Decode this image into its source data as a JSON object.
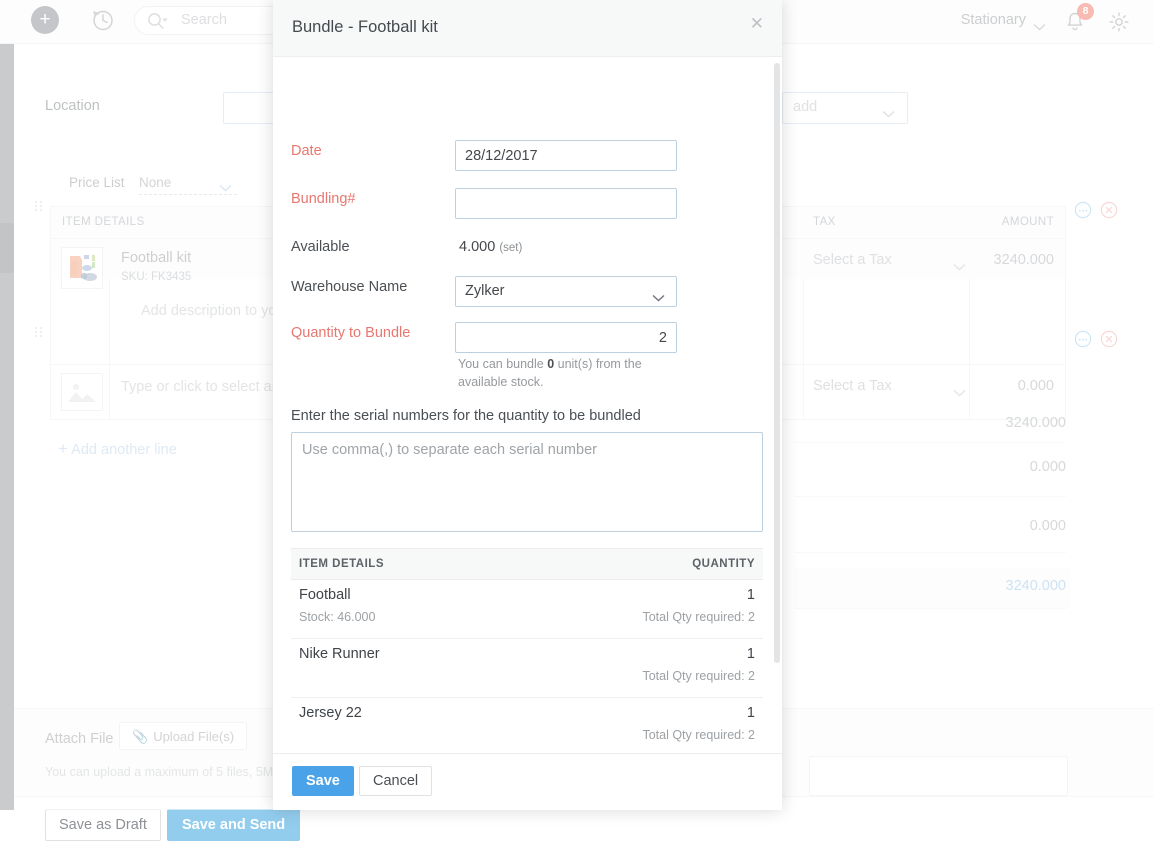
{
  "topbar": {
    "add_icon": "plus-circle-icon",
    "history_icon": "clock-history-icon",
    "search_placeholder": "Search",
    "search_icon": "search-icon",
    "organization": "Stationary",
    "org_caret_icon": "chevron-down-icon",
    "notifications_icon": "bell-icon",
    "notifications_count": "8",
    "settings_icon": "gear-icon"
  },
  "background_form": {
    "location_label": "Location",
    "location_value": "",
    "add_select_value": "add",
    "add_select_caret": "chevron-down-icon",
    "price_list_label": "Price List",
    "price_list_value": "None",
    "price_list_caret": "chevron-down-icon",
    "grid": {
      "columns": [
        "ITEM DETAILS",
        "TAX",
        "AMOUNT"
      ],
      "rows": [
        {
          "name": "Football kit",
          "sku": "SKU: FK3435",
          "description_placeholder": "Add description to your i",
          "tax": "Select a Tax",
          "amount": "3240.000",
          "thumbnail": "football-kit-thumbnail",
          "more_icon": "more-options-icon",
          "remove_icon": "remove-row-icon"
        },
        {
          "name": "",
          "sku": "",
          "description_placeholder": "Type or click to select an",
          "tax": "Select a Tax",
          "amount": "0.000",
          "thumbnail": "image-placeholder-icon",
          "more_icon": "more-options-icon",
          "remove_icon": "remove-row-icon"
        }
      ]
    },
    "add_line_label": "Add another line",
    "add_line_icon": "plus-icon",
    "totals": [
      "3240.000",
      "0.000",
      "0.000",
      "3240.000"
    ],
    "attach_label": "Attach File",
    "upload_button": "Upload File(s)",
    "upload_icon": "paperclip-icon",
    "attach_note": "You can upload a maximum of 5 files, 5MB",
    "save_draft_button": "Save as Draft",
    "save_send_button": "Save and Send"
  },
  "modal": {
    "title": "Bundle - Football kit",
    "close_icon": "close-icon",
    "fields": {
      "date_label": "Date",
      "date_value": "28/12/2017",
      "bundling_label": "Bundling#",
      "bundling_value": "",
      "available_label": "Available",
      "available_value": "4.000",
      "available_unit": "(set)",
      "warehouse_label": "Warehouse Name",
      "warehouse_value": "Zylker",
      "warehouse_caret": "chevron-down-icon",
      "quantity_label": "Quantity to Bundle",
      "quantity_value": "2",
      "quantity_hint_pre": "You can bundle ",
      "quantity_hint_strong": "0",
      "quantity_hint_post": " unit(s) from the available stock."
    },
    "serial": {
      "label": "Enter the serial numbers for the quantity to be bundled",
      "placeholder": "Use comma(,) to separate each serial number",
      "value": ""
    },
    "items_table": {
      "col_item": "ITEM DETAILS",
      "col_qty": "QUANTITY",
      "rows": [
        {
          "name": "Football",
          "stock": "Stock: 46.000",
          "qty": "1",
          "required": "Total Qty required: 2"
        },
        {
          "name": "Nike Runner",
          "stock": "",
          "qty": "1",
          "required": "Total Qty required: 2"
        },
        {
          "name": "Jersey 22",
          "stock": "",
          "qty": "1",
          "required": "Total Qty required: 2"
        }
      ]
    },
    "footer": {
      "save_button": "Save",
      "cancel_button": "Cancel"
    }
  },
  "colors": {
    "required_label": "#e8776f",
    "primary_button": "#4aa3e8",
    "badge": "#f0685a",
    "link": "#b6cfe6"
  }
}
